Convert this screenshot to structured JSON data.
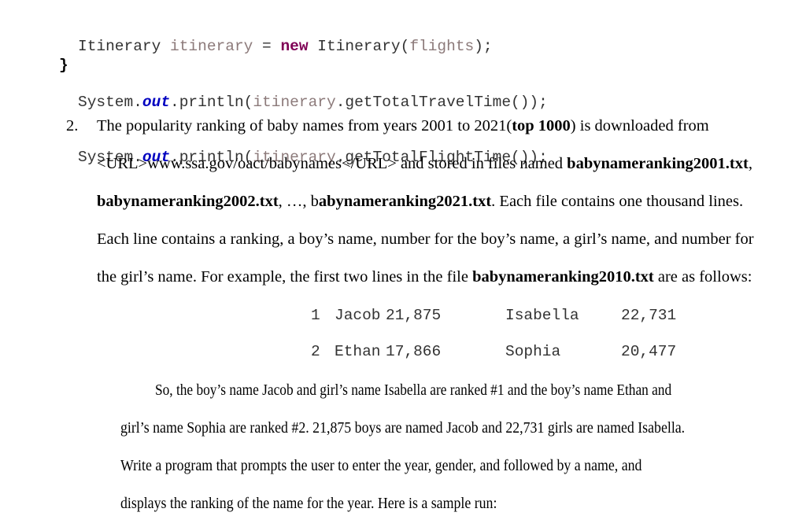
{
  "code": {
    "line1": {
      "type": "Itinerary",
      "var": "itinerary",
      "eq": " = ",
      "kw": "new",
      "ctor": " Itinerary(",
      "arg": "flights",
      "end": ");"
    },
    "line2": {
      "sys": "System.",
      "out": "out",
      "println": ".println(",
      "var": "itinerary",
      "method": ".getTotalTravelTime());"
    },
    "line3": {
      "sys": "System.",
      "out": "out",
      "println": ".println(",
      "var": "itinerary",
      "method": ".getTotalFlightTime());"
    },
    "closing_brace": "}"
  },
  "problem": {
    "number": "2.",
    "lines": [
      {
        "a": "The popularity ranking of baby names from years 2001 to 2021(",
        "b": "top 1000",
        "c": ") is downloaded from"
      },
      {
        "a": "<URL>www.ssa.gov/oact/babynames</URL> and stored in files named ",
        "b": "babynameranking2001.txt",
        "c": ","
      },
      {
        "a": "babynameranking2002.txt",
        "b": ", …, b",
        "c": "abynameranking2021.txt",
        "d": ". Each file contains one thousand lines."
      },
      {
        "a": "Each line contains a ranking, a boy’s name, number for the boy’s name, a girl’s name, and number for"
      },
      {
        "a": "the girl’s name. For example, the first two lines in the file ",
        "b": "babynameranking2010.txt",
        "c": " are as follows:"
      }
    ],
    "table": [
      {
        "rank": "1",
        "boy": "Jacob",
        "boy_count": "21,875",
        "girl": "Isabella",
        "girl_count": "22,731"
      },
      {
        "rank": "2",
        "boy": "Ethan",
        "boy_count": "17,866",
        "girl": "Sophia",
        "girl_count": "20,477"
      }
    ],
    "explanation": [
      "So, the boy’s name Jacob and girl’s name Isabella are ranked #1 and the boy’s name Ethan and",
      "girl’s name Sophia are ranked #2. 21,875 boys are named Jacob and 22,731 girls are named Isabella.",
      "Write a program that prompts the user to enter the year, gender, and followed by a name, and",
      "displays the ranking of the name for the year. Here is a sample run:"
    ]
  }
}
